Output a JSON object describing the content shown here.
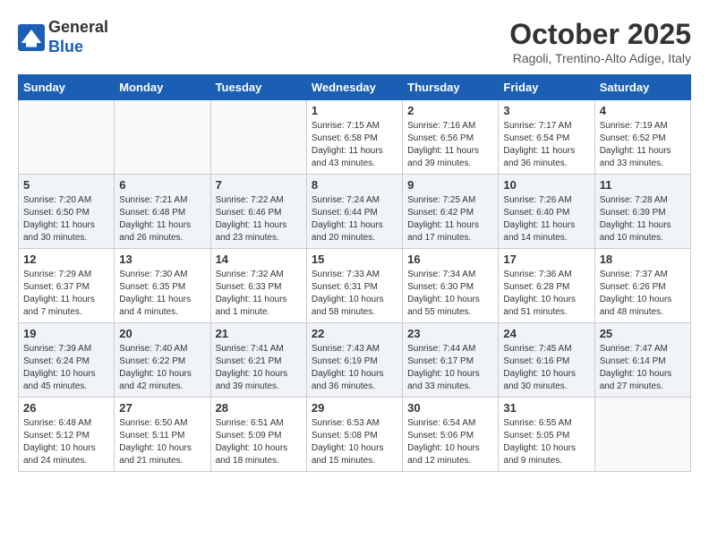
{
  "header": {
    "logo_line1": "General",
    "logo_line2": "Blue",
    "month_title": "October 2025",
    "location": "Ragoli, Trentino-Alto Adige, Italy"
  },
  "days_of_week": [
    "Sunday",
    "Monday",
    "Tuesday",
    "Wednesday",
    "Thursday",
    "Friday",
    "Saturday"
  ],
  "weeks": [
    [
      {
        "day": "",
        "info": ""
      },
      {
        "day": "",
        "info": ""
      },
      {
        "day": "",
        "info": ""
      },
      {
        "day": "1",
        "info": "Sunrise: 7:15 AM\nSunset: 6:58 PM\nDaylight: 11 hours\nand 43 minutes."
      },
      {
        "day": "2",
        "info": "Sunrise: 7:16 AM\nSunset: 6:56 PM\nDaylight: 11 hours\nand 39 minutes."
      },
      {
        "day": "3",
        "info": "Sunrise: 7:17 AM\nSunset: 6:54 PM\nDaylight: 11 hours\nand 36 minutes."
      },
      {
        "day": "4",
        "info": "Sunrise: 7:19 AM\nSunset: 6:52 PM\nDaylight: 11 hours\nand 33 minutes."
      }
    ],
    [
      {
        "day": "5",
        "info": "Sunrise: 7:20 AM\nSunset: 6:50 PM\nDaylight: 11 hours\nand 30 minutes."
      },
      {
        "day": "6",
        "info": "Sunrise: 7:21 AM\nSunset: 6:48 PM\nDaylight: 11 hours\nand 26 minutes."
      },
      {
        "day": "7",
        "info": "Sunrise: 7:22 AM\nSunset: 6:46 PM\nDaylight: 11 hours\nand 23 minutes."
      },
      {
        "day": "8",
        "info": "Sunrise: 7:24 AM\nSunset: 6:44 PM\nDaylight: 11 hours\nand 20 minutes."
      },
      {
        "day": "9",
        "info": "Sunrise: 7:25 AM\nSunset: 6:42 PM\nDaylight: 11 hours\nand 17 minutes."
      },
      {
        "day": "10",
        "info": "Sunrise: 7:26 AM\nSunset: 6:40 PM\nDaylight: 11 hours\nand 14 minutes."
      },
      {
        "day": "11",
        "info": "Sunrise: 7:28 AM\nSunset: 6:39 PM\nDaylight: 11 hours\nand 10 minutes."
      }
    ],
    [
      {
        "day": "12",
        "info": "Sunrise: 7:29 AM\nSunset: 6:37 PM\nDaylight: 11 hours\nand 7 minutes."
      },
      {
        "day": "13",
        "info": "Sunrise: 7:30 AM\nSunset: 6:35 PM\nDaylight: 11 hours\nand 4 minutes."
      },
      {
        "day": "14",
        "info": "Sunrise: 7:32 AM\nSunset: 6:33 PM\nDaylight: 11 hours\nand 1 minute."
      },
      {
        "day": "15",
        "info": "Sunrise: 7:33 AM\nSunset: 6:31 PM\nDaylight: 10 hours\nand 58 minutes."
      },
      {
        "day": "16",
        "info": "Sunrise: 7:34 AM\nSunset: 6:30 PM\nDaylight: 10 hours\nand 55 minutes."
      },
      {
        "day": "17",
        "info": "Sunrise: 7:36 AM\nSunset: 6:28 PM\nDaylight: 10 hours\nand 51 minutes."
      },
      {
        "day": "18",
        "info": "Sunrise: 7:37 AM\nSunset: 6:26 PM\nDaylight: 10 hours\nand 48 minutes."
      }
    ],
    [
      {
        "day": "19",
        "info": "Sunrise: 7:39 AM\nSunset: 6:24 PM\nDaylight: 10 hours\nand 45 minutes."
      },
      {
        "day": "20",
        "info": "Sunrise: 7:40 AM\nSunset: 6:22 PM\nDaylight: 10 hours\nand 42 minutes."
      },
      {
        "day": "21",
        "info": "Sunrise: 7:41 AM\nSunset: 6:21 PM\nDaylight: 10 hours\nand 39 minutes."
      },
      {
        "day": "22",
        "info": "Sunrise: 7:43 AM\nSunset: 6:19 PM\nDaylight: 10 hours\nand 36 minutes."
      },
      {
        "day": "23",
        "info": "Sunrise: 7:44 AM\nSunset: 6:17 PM\nDaylight: 10 hours\nand 33 minutes."
      },
      {
        "day": "24",
        "info": "Sunrise: 7:45 AM\nSunset: 6:16 PM\nDaylight: 10 hours\nand 30 minutes."
      },
      {
        "day": "25",
        "info": "Sunrise: 7:47 AM\nSunset: 6:14 PM\nDaylight: 10 hours\nand 27 minutes."
      }
    ],
    [
      {
        "day": "26",
        "info": "Sunrise: 6:48 AM\nSunset: 5:12 PM\nDaylight: 10 hours\nand 24 minutes."
      },
      {
        "day": "27",
        "info": "Sunrise: 6:50 AM\nSunset: 5:11 PM\nDaylight: 10 hours\nand 21 minutes."
      },
      {
        "day": "28",
        "info": "Sunrise: 6:51 AM\nSunset: 5:09 PM\nDaylight: 10 hours\nand 18 minutes."
      },
      {
        "day": "29",
        "info": "Sunrise: 6:53 AM\nSunset: 5:08 PM\nDaylight: 10 hours\nand 15 minutes."
      },
      {
        "day": "30",
        "info": "Sunrise: 6:54 AM\nSunset: 5:06 PM\nDaylight: 10 hours\nand 12 minutes."
      },
      {
        "day": "31",
        "info": "Sunrise: 6:55 AM\nSunset: 5:05 PM\nDaylight: 10 hours\nand 9 minutes."
      },
      {
        "day": "",
        "info": ""
      }
    ]
  ]
}
